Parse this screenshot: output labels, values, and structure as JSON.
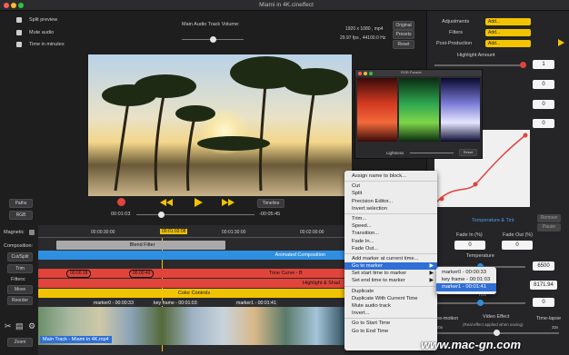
{
  "window": {
    "title": "Miami in 4K.cineffect"
  },
  "options": {
    "split_preview": "Split preview",
    "mute_audio": "Mute audio",
    "time_in_minutes": "Time in minutes"
  },
  "audio": {
    "volume_label": "Main Audio Track Volume:"
  },
  "video_info": {
    "resolution": "1920 x 1080 , mp4",
    "fps": "29.97 fps , 44100.0 Hz",
    "original": "Original",
    "presets": "Presets",
    "reset": "Reset"
  },
  "right_panel": {
    "adjustments": "Adjustments",
    "filters": "Filters",
    "post_production": "Post-Production",
    "add": "Add...",
    "highlight_amount": "Highlight Amount",
    "values": [
      "1",
      "0",
      "0",
      "0"
    ],
    "temp_tint": "Temperature & Tint",
    "remove": "Remove",
    "pause": "Pause",
    "fade_in": "Fade In (%)",
    "fade_out": "Fade Out (%)",
    "fade_in_val": "0",
    "fade_out_val": "0",
    "temperature": "Temperature",
    "temp_val": "6500",
    "tint": "Tint",
    "tint_val": "8171.94",
    "zero": "0",
    "slow_motion": "Slow-motion",
    "video_effect": "Video Effect",
    "time_lapse": "Time-lapse",
    "rt_note": "(Real effect applied when saving)",
    "speed_min": "1/10x",
    "speed_max": "32x"
  },
  "curves": {
    "title": "RGB Parade",
    "lightness": "Lightness",
    "reset": "Reset"
  },
  "transport": {
    "paths": "Paths",
    "rgb": "RGB",
    "time_current": "00:01:03",
    "time_remaining": "-00:05:45",
    "timeline": "Timeline"
  },
  "sidebar": {
    "magnetic": "Magnetic",
    "composition": "Composition:",
    "cut_split": "Cut/Split",
    "trim": "Trim",
    "filters": "Filters:",
    "move": "Move",
    "reorder": "Reorder",
    "zoom": "Zoom"
  },
  "ruler": [
    "00:00:30:00",
    "00:01:03:08",
    "00:01:30:00",
    "00:02:00:00"
  ],
  "tracks": {
    "blend": "Blend Filter",
    "animated": "Animated Composition",
    "tone_curve": "Tone Curve - B",
    "highlight": "Highlight & Shad",
    "color_controls": "Color Controls",
    "marker_a": "00:00:18",
    "marker_b": "00:00:46"
  },
  "markers": [
    {
      "label": "marker0 - 00:00:33"
    },
    {
      "label": "key frame - 00:01:03"
    },
    {
      "label": "marker1 - 00:01:41"
    }
  ],
  "main_track": "Main Track - Miami in 4K.mp4",
  "context_menu": {
    "group1": [
      "Assign name to block..."
    ],
    "group2": [
      "Cut",
      "Split",
      "Precision Editor...",
      "Invert selection"
    ],
    "group3": [
      "Trim...",
      "Speed...",
      "Transition...",
      "Fade In...",
      "Fade Out..."
    ],
    "group4": [
      "Add marker at current time...",
      "Go to marker",
      "Set start time to marker",
      "Set end time to marker"
    ],
    "group5": [
      "Duplicate",
      "Duplicate With Current Time",
      "Mute audio track",
      "Invert..."
    ],
    "group6": [
      "Go to Start Time",
      "Go to End Time"
    ]
  },
  "submenu": [
    "marker0 - 00:00:33",
    "key frame - 00:01:03",
    "marker1 - 00:01:41"
  ],
  "watermark": "www.mac-gn.com",
  "colors": {
    "accent": "#f2c300",
    "blue_track": "#2f8fe0",
    "red_track": "#e0443a",
    "yellow_track": "#f2c300",
    "menu_highlight": "#2f6fd6"
  }
}
